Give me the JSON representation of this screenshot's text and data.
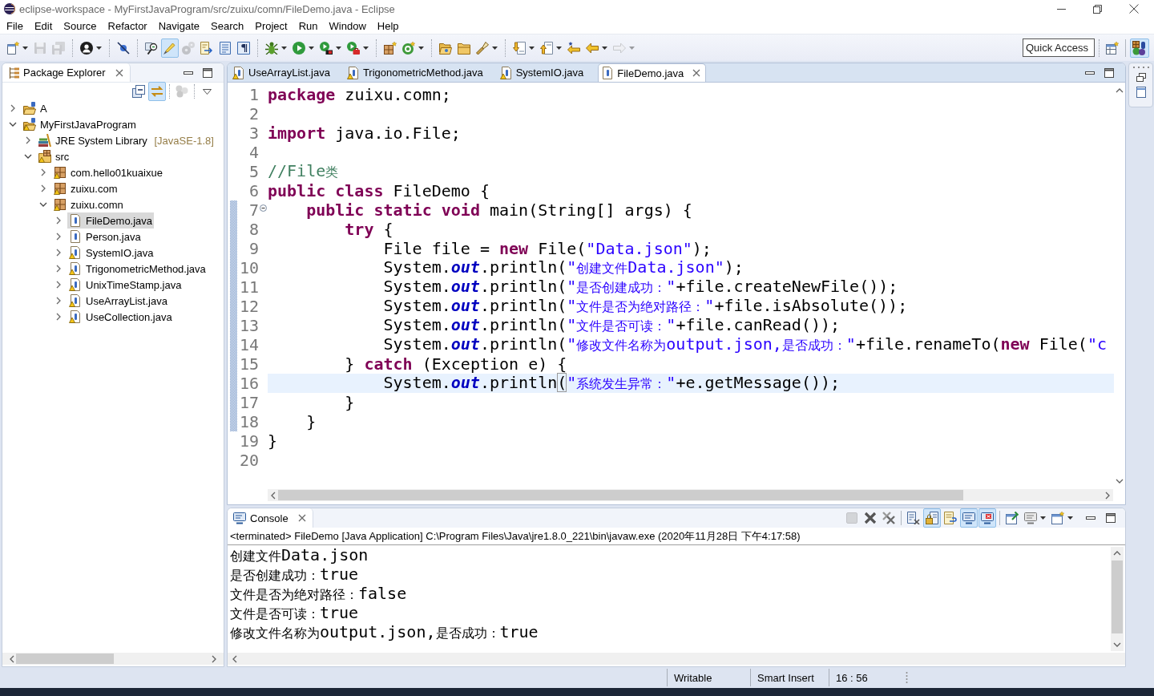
{
  "window": {
    "title": "eclipse-workspace - MyFirstJavaProgram/src/zuixu/comn/FileDemo.java - Eclipse"
  },
  "menu": [
    "File",
    "Edit",
    "Source",
    "Refactor",
    "Navigate",
    "Search",
    "Project",
    "Run",
    "Window",
    "Help"
  ],
  "toolbar": {
    "buttons": [
      {
        "pressed": false,
        "disabled": false
      },
      {
        "pressed": false,
        "disabled": true
      },
      {
        "pressed": false,
        "disabled": true
      },
      {
        "pressed": false,
        "disabled": false
      },
      {
        "pressed": false,
        "disabled": false
      },
      {
        "pressed": false,
        "disabled": false
      },
      {
        "pressed": true,
        "disabled": false
      },
      {
        "pressed": false,
        "disabled": true
      },
      {
        "pressed": false,
        "disabled": false
      },
      {
        "pressed": false,
        "disabled": false
      },
      {
        "pressed": false,
        "disabled": false
      },
      {
        "pressed": false,
        "disabled": false
      },
      {
        "pressed": false,
        "disabled": false
      },
      {
        "pressed": false,
        "disabled": false
      },
      {
        "pressed": false,
        "disabled": false
      },
      {
        "pressed": false,
        "disabled": false
      },
      {
        "pressed": false,
        "disabled": false
      },
      {
        "pressed": false,
        "disabled": false
      },
      {
        "pressed": false,
        "disabled": false
      },
      {
        "pressed": false,
        "disabled": false
      },
      {
        "pressed": false,
        "disabled": false
      },
      {
        "pressed": false,
        "disabled": false
      },
      {
        "pressed": false,
        "disabled": false
      },
      {
        "pressed": false,
        "disabled": false
      },
      {
        "pressed": false,
        "disabled": true
      }
    ]
  },
  "quick_access": {
    "placeholder": "Quick Access"
  },
  "perspectives": [
    {
      "selected": false
    },
    {
      "selected": true
    }
  ],
  "package_explorer": {
    "title": "Package Explorer",
    "view_buttons": [
      {
        "pressed": false,
        "disabled": false
      },
      {
        "pressed": true,
        "disabled": false
      },
      {
        "pressed": false,
        "disabled": true
      },
      {
        "pressed": false,
        "disabled": false
      }
    ],
    "tree": [
      {
        "label": "A",
        "kind": "project",
        "expanded": false,
        "selected": false,
        "warning": false
      },
      {
        "label": "MyFirstJavaProgram",
        "kind": "project",
        "expanded": true,
        "selected": false,
        "warning": true,
        "children": [
          {
            "label": "JRE System Library",
            "decoration": "[JavaSE-1.8]",
            "kind": "library",
            "expanded": false,
            "selected": false,
            "warning": false
          },
          {
            "label": "src",
            "kind": "source-folder",
            "expanded": true,
            "selected": false,
            "warning": true,
            "children": [
              {
                "label": "com.hello01kuaixue",
                "kind": "package",
                "expanded": false,
                "selected": false,
                "warning": true
              },
              {
                "label": "zuixu.com",
                "kind": "package",
                "expanded": false,
                "selected": false,
                "warning": true
              },
              {
                "label": "zuixu.comn",
                "kind": "package",
                "expanded": true,
                "selected": false,
                "warning": true,
                "children": [
                  {
                    "label": "FileDemo.java",
                    "kind": "java-file",
                    "expanded": false,
                    "selected": true,
                    "warning": false
                  },
                  {
                    "label": "Person.java",
                    "kind": "java-file",
                    "expanded": false,
                    "selected": false,
                    "warning": false
                  },
                  {
                    "label": "SystemIO.java",
                    "kind": "java-file",
                    "expanded": false,
                    "selected": false,
                    "warning": true
                  },
                  {
                    "label": "TrigonometricMethod.java",
                    "kind": "java-file",
                    "expanded": false,
                    "selected": false,
                    "warning": true
                  },
                  {
                    "label": "UnixTimeStamp.java",
                    "kind": "java-file",
                    "expanded": false,
                    "selected": false,
                    "warning": true
                  },
                  {
                    "label": "UseArrayList.java",
                    "kind": "java-file",
                    "expanded": false,
                    "selected": false,
                    "warning": true
                  },
                  {
                    "label": "UseCollection.java",
                    "kind": "java-file",
                    "expanded": false,
                    "selected": false,
                    "warning": true
                  }
                ]
              }
            ]
          }
        ]
      }
    ]
  },
  "editor": {
    "tabs": [
      {
        "label": "UseArrayList.java",
        "selected": false,
        "warning": true
      },
      {
        "label": "TrigonometricMethod.java",
        "selected": false,
        "warning": true
      },
      {
        "label": "SystemIO.java",
        "selected": false,
        "warning": true
      },
      {
        "label": "FileDemo.java",
        "selected": true,
        "warning": false
      }
    ],
    "lines": [
      {
        "number": "1",
        "tokens": [
          {
            "kind": "keyword",
            "text": "package"
          },
          {
            "kind": "plain",
            "text": " zuixu.comn;"
          }
        ],
        "current": false,
        "fold_marker": false,
        "in_range": false
      },
      {
        "number": "2",
        "current": false,
        "fold_marker": false,
        "in_range": false
      },
      {
        "number": "3",
        "tokens": [
          {
            "kind": "keyword",
            "text": "import"
          },
          {
            "kind": "plain",
            "text": " java.io.File;"
          }
        ],
        "current": false,
        "fold_marker": false,
        "in_range": false
      },
      {
        "number": "4",
        "current": false,
        "fold_marker": false,
        "in_range": false
      },
      {
        "number": "5",
        "tokens": [
          {
            "kind": "comment",
            "text": "//File类"
          }
        ],
        "current": false,
        "fold_marker": false,
        "in_range": false
      },
      {
        "number": "6",
        "tokens": [
          {
            "kind": "keyword",
            "text": "public"
          },
          {
            "kind": "keyword",
            "text": " class"
          },
          {
            "kind": "plain",
            "text": " FileDemo {"
          }
        ],
        "current": false,
        "fold_marker": false,
        "in_range": false
      },
      {
        "number": "7",
        "tokens": [
          {
            "kind": "keyword",
            "text": "    public"
          },
          {
            "kind": "keyword",
            "text": " static"
          },
          {
            "kind": "keyword",
            "text": " void"
          },
          {
            "kind": "plain",
            "text": " main(String[] args) {"
          }
        ],
        "current": false,
        "fold_marker": true,
        "in_range": true
      },
      {
        "number": "8",
        "tokens": [
          {
            "kind": "keyword",
            "text": "        try"
          },
          {
            "kind": "plain",
            "text": " {"
          }
        ],
        "current": false,
        "fold_marker": false,
        "in_range": true
      },
      {
        "number": "9",
        "tokens": [
          {
            "kind": "plain",
            "text": "            File file = "
          },
          {
            "kind": "keyword",
            "text": "new"
          },
          {
            "kind": "plain",
            "text": " File("
          },
          {
            "kind": "string",
            "text": "\"Data.json\""
          },
          {
            "kind": "plain",
            "text": ");"
          }
        ],
        "current": false,
        "fold_marker": false,
        "in_range": true
      },
      {
        "number": "10",
        "tokens": [
          {
            "kind": "plain",
            "text": "            System."
          },
          {
            "kind": "field",
            "text": "out"
          },
          {
            "kind": "plain",
            "text": ".println("
          },
          {
            "kind": "string",
            "text": "\"创建文件Data.json\""
          },
          {
            "kind": "plain",
            "text": ");"
          }
        ],
        "current": false,
        "fold_marker": false,
        "in_range": true
      },
      {
        "number": "11",
        "tokens": [
          {
            "kind": "plain",
            "text": "            System."
          },
          {
            "kind": "field",
            "text": "out"
          },
          {
            "kind": "plain",
            "text": ".println("
          },
          {
            "kind": "string",
            "text": "\"是否创建成功：\""
          },
          {
            "kind": "plain",
            "text": "+file.createNewFile());"
          }
        ],
        "current": false,
        "fold_marker": false,
        "in_range": true
      },
      {
        "number": "12",
        "tokens": [
          {
            "kind": "plain",
            "text": "            System."
          },
          {
            "kind": "field",
            "text": "out"
          },
          {
            "kind": "plain",
            "text": ".println("
          },
          {
            "kind": "string",
            "text": "\"文件是否为绝对路径：\""
          },
          {
            "kind": "plain",
            "text": "+file.isAbsolute());"
          }
        ],
        "current": false,
        "fold_marker": false,
        "in_range": true
      },
      {
        "number": "13",
        "tokens": [
          {
            "kind": "plain",
            "text": "            System."
          },
          {
            "kind": "field",
            "text": "out"
          },
          {
            "kind": "plain",
            "text": ".println("
          },
          {
            "kind": "string",
            "text": "\"文件是否可读：\""
          },
          {
            "kind": "plain",
            "text": "+file.canRead());"
          }
        ],
        "current": false,
        "fold_marker": false,
        "in_range": true
      },
      {
        "number": "14",
        "tokens": [
          {
            "kind": "plain",
            "text": "            System."
          },
          {
            "kind": "field",
            "text": "out"
          },
          {
            "kind": "plain",
            "text": ".println("
          },
          {
            "kind": "string",
            "text": "\"修改文件名称为output.json,是否成功：\""
          },
          {
            "kind": "plain",
            "text": "+file.renameTo("
          },
          {
            "kind": "keyword",
            "text": "new"
          },
          {
            "kind": "plain",
            "text": " File("
          },
          {
            "kind": "string",
            "text": "\"c"
          }
        ],
        "current": false,
        "fold_marker": false,
        "in_range": true
      },
      {
        "number": "15",
        "tokens": [
          {
            "kind": "plain",
            "text": "        } "
          },
          {
            "kind": "keyword",
            "text": "catch"
          },
          {
            "kind": "plain",
            "text": " (Exception e) {"
          }
        ],
        "current": false,
        "fold_marker": false,
        "in_range": true
      },
      {
        "number": "16",
        "tokens": [
          {
            "kind": "plain",
            "text": "            System."
          },
          {
            "kind": "field",
            "text": "out"
          },
          {
            "kind": "plain",
            "text": ".println"
          },
          {
            "kind": "bracket",
            "text": "("
          },
          {
            "kind": "string",
            "text": "\"系统发生异常：\""
          },
          {
            "kind": "plain",
            "text": "+e.getMessage());"
          }
        ],
        "current": true,
        "fold_marker": false,
        "in_range": true
      },
      {
        "number": "17",
        "tokens": [
          {
            "kind": "plain",
            "text": "        }"
          }
        ],
        "current": false,
        "fold_marker": false,
        "in_range": true
      },
      {
        "number": "18",
        "tokens": [
          {
            "kind": "plain",
            "text": "    }"
          }
        ],
        "current": false,
        "fold_marker": false,
        "in_range": true
      },
      {
        "number": "19",
        "tokens": [
          {
            "kind": "plain",
            "text": "}"
          }
        ],
        "current": false,
        "fold_marker": false,
        "in_range": false
      },
      {
        "number": "20",
        "current": false,
        "fold_marker": false,
        "in_range": false
      }
    ]
  },
  "console": {
    "title": "Console",
    "buttons": [
      {
        "pressed": false,
        "disabled": true
      },
      {
        "pressed": false,
        "disabled": false
      },
      {
        "pressed": false,
        "disabled": false
      },
      {
        "pressed": false,
        "disabled": false
      },
      {
        "pressed": true,
        "disabled": false
      },
      {
        "pressed": false,
        "disabled": false
      },
      {
        "pressed": true,
        "disabled": false
      },
      {
        "pressed": true,
        "disabled": false
      },
      {
        "pressed": false,
        "disabled": false
      },
      {
        "pressed": false,
        "disabled": false
      },
      {
        "pressed": false,
        "disabled": false
      }
    ],
    "status": "<terminated> FileDemo [Java Application] C:\\Program Files\\Java\\jre1.8.0_221\\bin\\javaw.exe (2020年11月28日 下午4:17:58)",
    "output": [
      "创建文件Data.json",
      "是否创建成功：true",
      "文件是否为绝对路径：false",
      "文件是否可读：true",
      "修改文件名称为output.json,是否成功：true"
    ]
  },
  "status_bar": [
    "Writable",
    "Smart Insert",
    "16 : 56"
  ]
}
